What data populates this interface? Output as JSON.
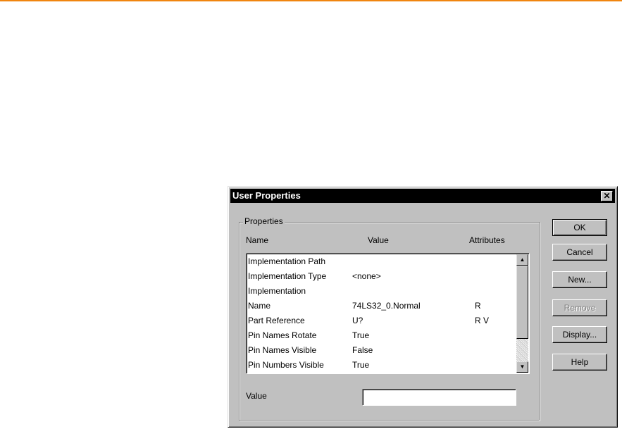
{
  "dialog": {
    "title": "User Properties",
    "close_glyph": "✕",
    "group_label": "Properties",
    "columns": {
      "name": "Name",
      "value": "Value",
      "attributes": "Attributes"
    },
    "rows": [
      {
        "name": "Implementation Path",
        "value": "",
        "attr": ""
      },
      {
        "name": "Implementation Type",
        "value": "<none>",
        "attr": ""
      },
      {
        "name": "Implementation",
        "value": "",
        "attr": ""
      },
      {
        "name": "Name",
        "value": "74LS32_0.Normal",
        "attr": "R"
      },
      {
        "name": "Part Reference",
        "value": "U?",
        "attr": "R V"
      },
      {
        "name": "Pin Names Rotate",
        "value": "True",
        "attr": ""
      },
      {
        "name": "Pin Names Visible",
        "value": "False",
        "attr": ""
      },
      {
        "name": "Pin Numbers Visible",
        "value": "True",
        "attr": ""
      }
    ],
    "value_label": "Value",
    "value_input": ""
  },
  "buttons": {
    "ok": "OK",
    "cancel": "Cancel",
    "new": "New...",
    "remove": "Remove",
    "display": "Display...",
    "help": "Help"
  },
  "icons": {
    "close": "close-icon",
    "scroll_up": "scroll-up-icon",
    "scroll_down": "scroll-down-icon"
  },
  "colors": {
    "accent_rule": "#f0850f",
    "title_bar": "#000000",
    "dialog_face": "#c0c0c0"
  }
}
